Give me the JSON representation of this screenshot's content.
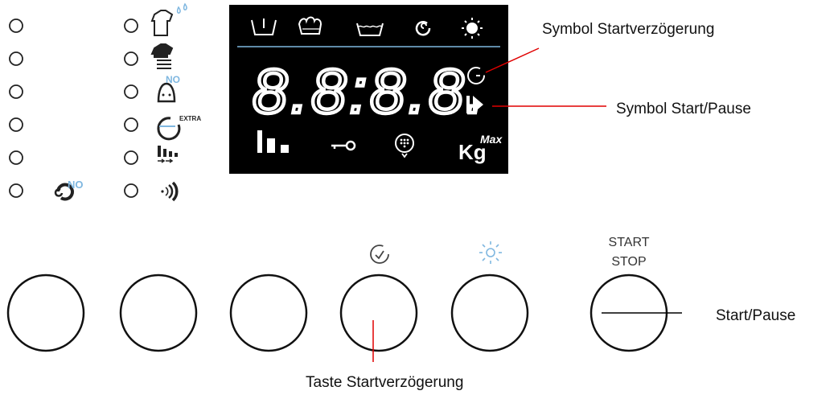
{
  "annotations": {
    "delay_symbol": "Symbol Startverzögerung",
    "start_pause_symbol": "Symbol Start/Pause",
    "start_pause_button": "Start/Pause",
    "delay_button": "Taste Startverzögerung"
  },
  "display": {
    "digits": "8.8:8.8.",
    "max_label": "Max",
    "kg_label": "Kg"
  },
  "panel": {
    "no_label": "NO",
    "extra_label": "EXTRA"
  },
  "buttons": {
    "start_stop_top": "START",
    "start_stop_bottom": "STOP"
  },
  "colors": {
    "display_bg": "#000000",
    "accent_blue": "#7fb7e0",
    "annotation_line": "#e00000"
  }
}
